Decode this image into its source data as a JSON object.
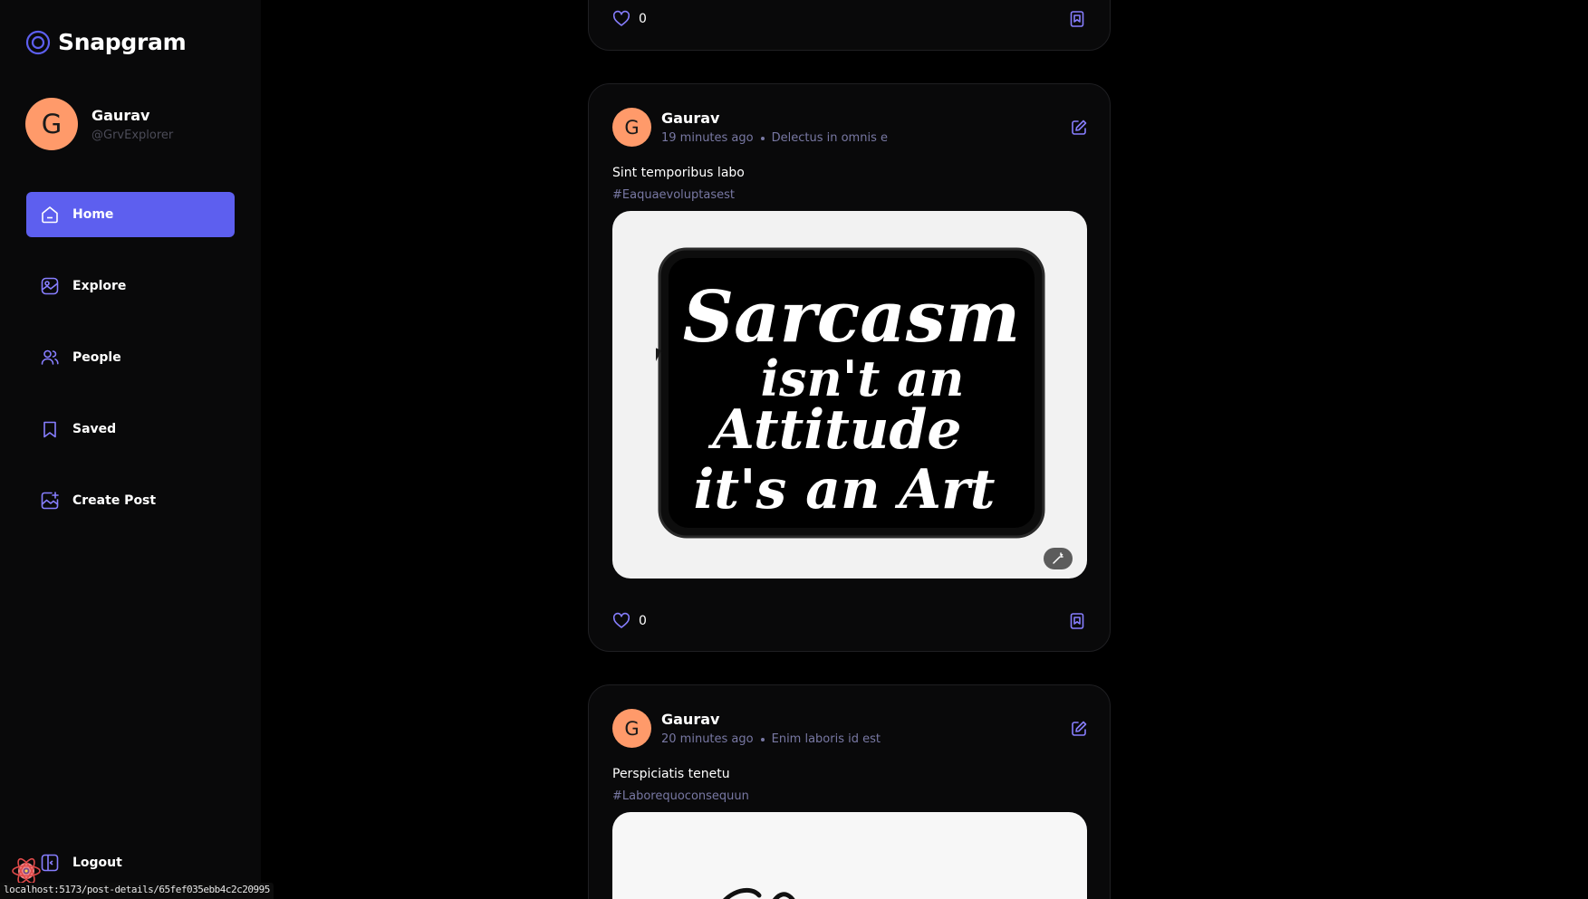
{
  "app": {
    "name": "Snapgram",
    "accent": "#5d5fef",
    "avatar_color": "#ff9a6a"
  },
  "profile": {
    "initial": "G",
    "name": "Gaurav",
    "handle": "@GrvExplorer"
  },
  "nav": {
    "items": [
      {
        "label": "Home",
        "icon": "home-icon",
        "active": true
      },
      {
        "label": "Explore",
        "icon": "explore-icon",
        "active": false
      },
      {
        "label": "People",
        "icon": "people-icon",
        "active": false
      },
      {
        "label": "Saved",
        "icon": "bookmark-icon",
        "active": false
      },
      {
        "label": "Create Post",
        "icon": "create-post-icon",
        "active": false
      }
    ],
    "logout_label": "Logout"
  },
  "status_bar": {
    "url": "localhost:5173/post-details/65fef035ebb4c2c20995"
  },
  "posts": [
    {
      "likes": "0"
    },
    {
      "initial": "G",
      "author": "Gaurav",
      "time": "19 minutes ago",
      "location": "Delectus in omnis e",
      "caption": "Sint temporibus labo",
      "tags": "#Eaquaevoluptasest",
      "image_text": [
        "Sarcasm",
        "isn't an",
        "Attitude",
        "it's an Art"
      ],
      "likes": "0"
    },
    {
      "initial": "G",
      "author": "Gaurav",
      "time": "20 minutes ago",
      "location": "Enim laboris id est",
      "caption": "Perspiciatis tenetu",
      "tags": "#Laborequoconsequun"
    }
  ]
}
